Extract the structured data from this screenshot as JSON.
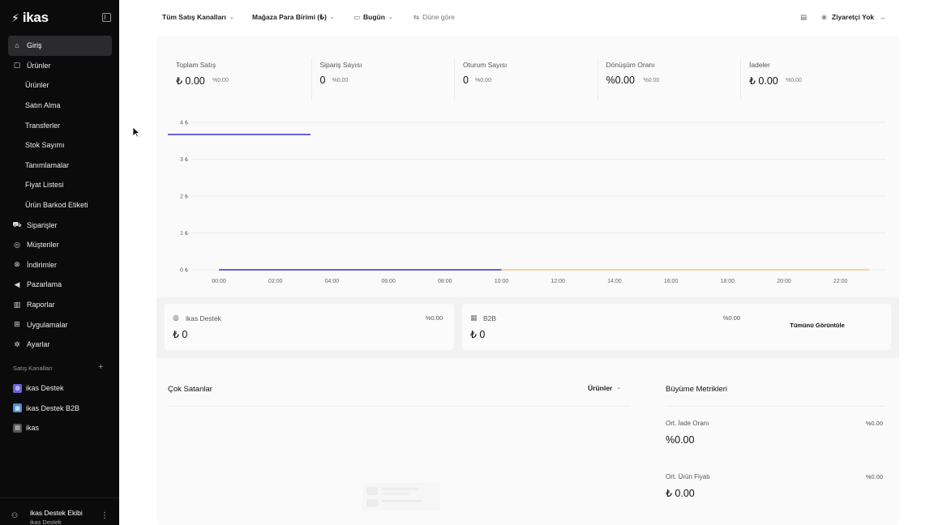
{
  "app": {
    "logo_text": "ikas",
    "logo_mark": "⚡"
  },
  "sidebar": {
    "items": [
      {
        "label": "Giriş",
        "icon": "home-icon",
        "glyph": "⌂",
        "active": true
      },
      {
        "label": "Ürünler",
        "icon": "bag-icon",
        "glyph": "▢"
      },
      {
        "label": "Ürünler",
        "sub": true
      },
      {
        "label": "Satın Alma",
        "sub": true
      },
      {
        "label": "Transferler",
        "sub": true
      },
      {
        "label": "Stok Sayımı",
        "sub": true
      },
      {
        "label": "Tanımlamalar",
        "sub": true
      },
      {
        "label": "Fiyat Listesi",
        "sub": true
      },
      {
        "label": "Ürün Barkod Etiketi",
        "sub": true
      },
      {
        "label": "Siparişler",
        "icon": "cart-icon",
        "glyph": "⛟"
      },
      {
        "label": "Müşteriler",
        "icon": "user-circle-icon",
        "glyph": "◎"
      },
      {
        "label": "İndirimler",
        "icon": "discount-icon",
        "glyph": "⊗"
      },
      {
        "label": "Pazarlama",
        "icon": "megaphone-icon",
        "glyph": "◀"
      },
      {
        "label": "Raporlar",
        "icon": "bar-chart-icon",
        "glyph": "▥"
      },
      {
        "label": "Uygulamalar",
        "icon": "apps-grid-icon",
        "glyph": "⊞"
      },
      {
        "label": "Ayarlar",
        "icon": "gear-icon",
        "glyph": "✲"
      }
    ],
    "channels_label": "Satış Kanalları",
    "channels": [
      {
        "label": "ikas Destek",
        "icon": "globe-icon",
        "glyph": "◍",
        "color": "#6b63d6"
      },
      {
        "label": "ikas Destek B2B",
        "icon": "b2b-icon",
        "glyph": "▦",
        "color": "#4a90d9"
      },
      {
        "label": "ikas",
        "icon": "pos-icon",
        "glyph": "▤",
        "color": "#555555"
      }
    ],
    "user": {
      "name": "ikas Destek Ekibi",
      "store": "ikas Destek"
    }
  },
  "topbar": {
    "channel_filter": "Tüm Satış Kanalları",
    "currency_filter": "Mağaza Para Birimi (₺)",
    "date_filter": "Bugün",
    "compare": "Düne göre",
    "visitors": "Ziyaretçi Yok"
  },
  "metrics": [
    {
      "label": "Toplam Satış",
      "value": "₺ 0.00",
      "pct": "%0.00"
    },
    {
      "label": "Sipariş Sayısı",
      "value": "0",
      "pct": "%0.00"
    },
    {
      "label": "Oturum Sayısı",
      "value": "0",
      "pct": "%0.00"
    },
    {
      "label": "Dönüşüm Oranı",
      "value": "%0.00",
      "pct": "%0.00"
    },
    {
      "label": "İadeler",
      "value": "₺ 0.00",
      "pct": "%0.00"
    }
  ],
  "chart_data": {
    "type": "line",
    "x": [
      "00:00",
      "02:00",
      "04:00",
      "06:00",
      "08:00",
      "10:00",
      "12:00",
      "14:00",
      "16:00",
      "18:00",
      "20:00",
      "22:00"
    ],
    "y_ticks": [
      "0 ₺",
      "1 ₺",
      "2 ₺",
      "3 ₺",
      "4 ₺"
    ],
    "ylim": [
      0,
      4
    ],
    "grid": true,
    "series": [
      {
        "values": [
          0,
          0,
          0,
          0,
          0,
          0
        ],
        "color": "#6b63d6"
      },
      {
        "values": [
          0,
          0,
          0,
          0,
          0,
          0,
          0
        ],
        "color": "#f3d59c"
      }
    ]
  },
  "stat_cards": [
    {
      "name": "ikas Destek",
      "icon": "globe-icon",
      "glyph": "◍",
      "pct": "%0.00",
      "value": "₺ 0"
    },
    {
      "name": "B2B",
      "icon": "b2b-icon",
      "glyph": "▦",
      "pct": "%0.00",
      "value": "₺ 0"
    }
  ],
  "view_all": "Tümünü Görüntüle",
  "best_sellers": {
    "title": "Çok Satanlar",
    "filter": "Ürünler"
  },
  "growth": {
    "title": "Büyüme Metrikleri",
    "items": [
      {
        "label": "Ort. İade Oranı",
        "pct": "%0.00",
        "value": "%0.00"
      },
      {
        "label": "Ort. Ürün Fiyatı",
        "pct": "%0.00",
        "value": "₺ 0.00"
      }
    ]
  },
  "colors": {
    "accent": "#6b63d6",
    "comparison": "#f3d59c",
    "sidebar_bg": "#0b0b0c"
  }
}
